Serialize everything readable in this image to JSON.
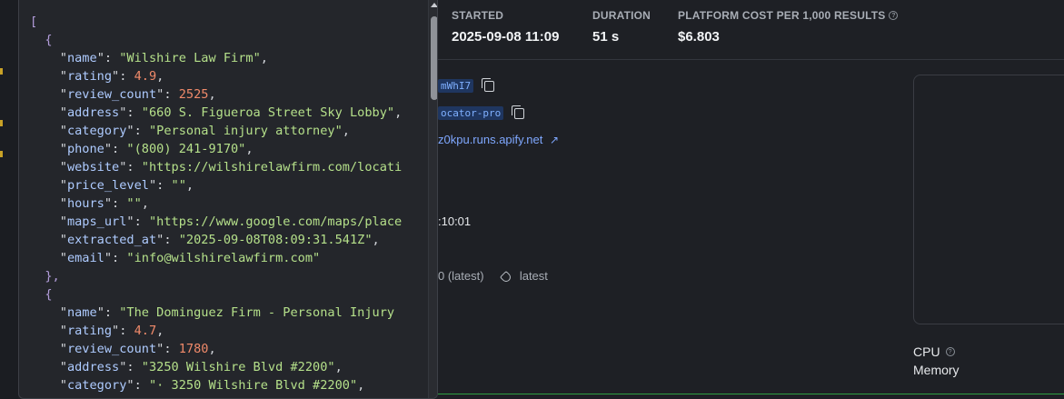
{
  "stats": [
    {
      "label": "STARTED",
      "value": "2025-09-08 11:09",
      "help": false
    },
    {
      "label": "DURATION",
      "value": "51 s",
      "help": false
    },
    {
      "label": "PLATFORM COST PER 1,000 RESULTS",
      "value": "$6.803",
      "help": true
    }
  ],
  "details": {
    "run_id_fragment": "mWhI7",
    "actor_fragment": "ocator-pro",
    "url_fragment": "z0kpu.runs.apify.net",
    "time_fragment": ":10:01",
    "build_fragment": "0 (latest)",
    "build_tag": "latest"
  },
  "metrics": {
    "cpu": "CPU",
    "memory": "Memory"
  },
  "icons": {
    "copy": "copy-icon",
    "external": "external-link-icon",
    "tag": "tag-icon",
    "help": "help-circle-icon"
  },
  "colors": {
    "json_key": "#aecbff",
    "json_string": "#b5e08a",
    "json_number": "#f08a6a",
    "link": "#7fa8ff",
    "success": "#2ea043"
  },
  "json_lines": [
    {
      "indent": 0,
      "text": "["
    },
    {
      "indent": 1,
      "text": "{"
    },
    {
      "indent": 2,
      "key": "name",
      "value": "\"Wilshire Law Firm\"",
      "type": "string",
      "comma": true
    },
    {
      "indent": 2,
      "key": "rating",
      "value": "4.9",
      "type": "number",
      "comma": true
    },
    {
      "indent": 2,
      "key": "review_count",
      "value": "2525",
      "type": "number",
      "comma": true
    },
    {
      "indent": 2,
      "key": "address",
      "value": "\"660 S. Figueroa Street Sky Lobby\"",
      "type": "string",
      "comma": true
    },
    {
      "indent": 2,
      "key": "category",
      "value": "\"Personal injury attorney\"",
      "type": "string",
      "comma": true
    },
    {
      "indent": 2,
      "key": "phone",
      "value": "\"(800) 241-9170\"",
      "type": "string",
      "comma": true
    },
    {
      "indent": 2,
      "key": "website",
      "value": "\"https://wilshirelawfirm.com/locati",
      "type": "string",
      "comma": false
    },
    {
      "indent": 2,
      "key": "price_level",
      "value": "\"\"",
      "type": "string",
      "comma": true
    },
    {
      "indent": 2,
      "key": "hours",
      "value": "\"\"",
      "type": "string",
      "comma": true
    },
    {
      "indent": 2,
      "key": "maps_url",
      "value": "\"https://www.google.com/maps/place",
      "type": "string",
      "comma": false
    },
    {
      "indent": 2,
      "key": "extracted_at",
      "value": "\"2025-09-08T08:09:31.541Z\"",
      "type": "string",
      "comma": true
    },
    {
      "indent": 2,
      "key": "email",
      "value": "\"info@wilshirelawfirm.com\"",
      "type": "string",
      "comma": false
    },
    {
      "indent": 1,
      "text": "},"
    },
    {
      "indent": 1,
      "text": "{"
    },
    {
      "indent": 2,
      "key": "name",
      "value": "\"The Dominguez Firm - Personal Injury",
      "type": "string",
      "comma": false
    },
    {
      "indent": 2,
      "key": "rating",
      "value": "4.7",
      "type": "number",
      "comma": true
    },
    {
      "indent": 2,
      "key": "review_count",
      "value": "1780",
      "type": "number",
      "comma": true
    },
    {
      "indent": 2,
      "key": "address",
      "value": "\"3250 Wilshire Blvd #2200\"",
      "type": "string",
      "comma": true
    },
    {
      "indent": 2,
      "key": "category",
      "value": "\"· 3250 Wilshire Blvd #2200\"",
      "type": "string",
      "comma": true
    }
  ]
}
